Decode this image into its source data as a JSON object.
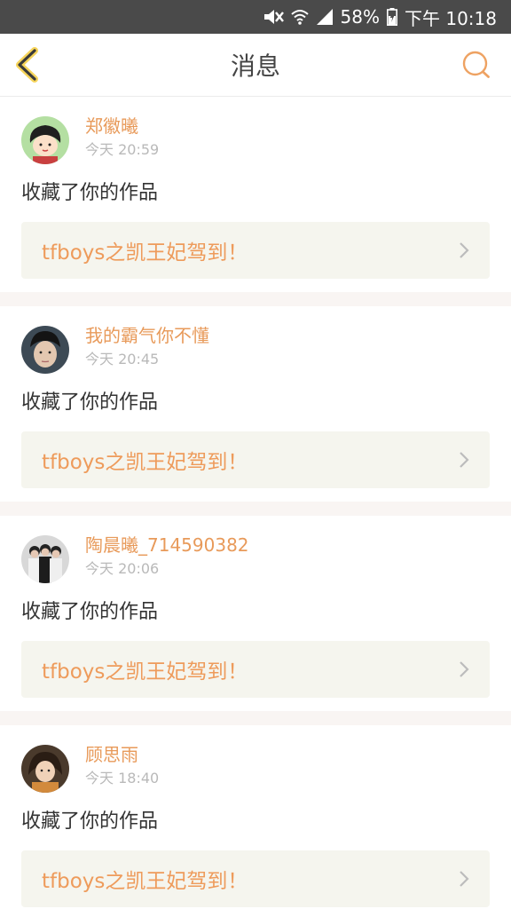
{
  "status_bar": {
    "battery": "58%",
    "time": "下午 10:18",
    "icons": [
      "mute-icon",
      "wifi-icon",
      "signal-icon",
      "battery-icon"
    ]
  },
  "app_bar": {
    "title": "消息",
    "back_icon": "chevron-left-icon",
    "search_icon": "search-icon"
  },
  "colors": {
    "accent": "#e89a5a",
    "status_bar_bg": "#4a4a4a",
    "work_bg": "#f5f5ee",
    "separator": "#f9f5f3"
  },
  "messages": [
    {
      "user": "郑徽曦",
      "time": "今天 20:59",
      "action": "收藏了你的作品",
      "work_title": "tfboys之凯王妃驾到！"
    },
    {
      "user": "我的霸气你不懂",
      "time": "今天 20:45",
      "action": "收藏了你的作品",
      "work_title": "tfboys之凯王妃驾到！"
    },
    {
      "user": "陶晨曦_714590382",
      "time": "今天 20:06",
      "action": "收藏了你的作品",
      "work_title": "tfboys之凯王妃驾到！"
    },
    {
      "user": "顾思雨",
      "time": "今天 18:40",
      "action": "收藏了你的作品",
      "work_title": "tfboys之凯王妃驾到！"
    }
  ]
}
